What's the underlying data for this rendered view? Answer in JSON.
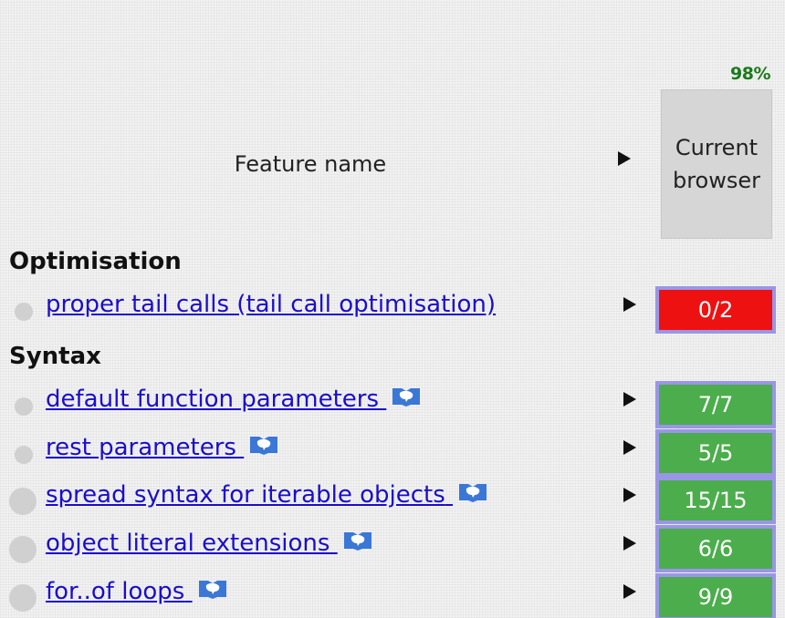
{
  "summary": {
    "percent": "98%"
  },
  "header": {
    "feature_name": "Feature name",
    "browser_column": "Current browser"
  },
  "colors": {
    "pass": "#4cad4c",
    "fail": "#ee1111",
    "link": "#1a0dcc",
    "score_border": "#9a96e6",
    "percent": "#1b7a1b"
  },
  "categories": [
    {
      "name": "Optimisation",
      "features": [
        {
          "label": "proper tail calls (tail call optimisation)",
          "score": "0/2",
          "status": "fail",
          "has_mdn_icon": false
        }
      ]
    },
    {
      "name": "Syntax",
      "features": [
        {
          "label": "default function parameters",
          "score": "7/7",
          "status": "pass",
          "has_mdn_icon": true
        },
        {
          "label": "rest parameters",
          "score": "5/5",
          "status": "pass",
          "has_mdn_icon": true
        },
        {
          "label": "spread syntax for iterable objects",
          "score": "15/15",
          "status": "pass",
          "has_mdn_icon": true
        },
        {
          "label": "object literal extensions",
          "score": "6/6",
          "status": "pass",
          "has_mdn_icon": true
        },
        {
          "label": "for..of loops",
          "score": "9/9",
          "status": "pass",
          "has_mdn_icon": true
        }
      ]
    }
  ]
}
